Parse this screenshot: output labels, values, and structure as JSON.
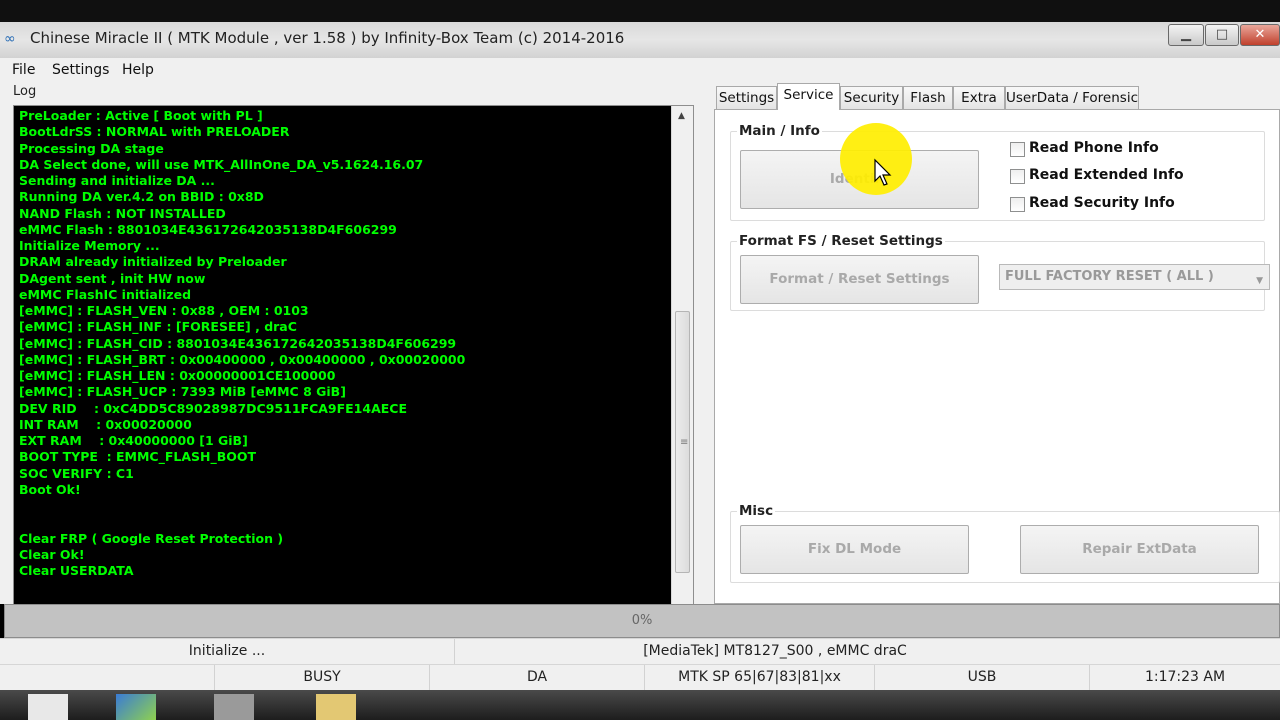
{
  "window": {
    "title": "Chinese Miracle II ( MTK Module , ver 1.58 ) by Infinity-Box Team (c) 2014-2016",
    "buttons": {
      "minimize": "▁",
      "maximize": "□",
      "close": "✕"
    }
  },
  "menu": [
    "File",
    "Settings",
    "Help"
  ],
  "log": {
    "label": "Log",
    "lines": [
      "PreLoader : Active [ Boot with PL ]",
      "BootLdrSS : NORMAL with PRELOADER",
      "Processing DA stage",
      "DA Select done, will use MTK_AllInOne_DA_v5.1624.16.07",
      "Sending and initialize DA ...",
      "Running DA ver.4.2 on BBID : 0x8D",
      "NAND Flash : NOT INSTALLED",
      "eMMC Flash : 8801034E436172642035138D4F606299",
      "Initialize Memory ...",
      "DRAM already initialized by Preloader",
      "DAgent sent , init HW now",
      "eMMC FlashIC initialized",
      "[eMMC] : FLASH_VEN : 0x88 , OEM : 0103",
      "[eMMC] : FLASH_INF : [FORESEE] , draC",
      "[eMMC] : FLASH_CID : 8801034E436172642035138D4F606299",
      "[eMMC] : FLASH_BRT : 0x00400000 , 0x00400000 , 0x00020000",
      "[eMMC] : FLASH_LEN : 0x00000001CE100000",
      "[eMMC] : FLASH_UCP : 7393 MiB [eMMC 8 GiB]",
      "DEV RID    : 0xC4DD5C89028987DC9511FCA9FE14AECE",
      "INT RAM    : 0x00020000",
      "EXT RAM    : 0x40000000 [1 GiB]",
      "BOOT TYPE  : EMMC_FLASH_BOOT",
      "SOC VERIFY : C1",
      "Boot Ok!",
      "",
      "",
      "Clear FRP ( Google Reset Protection )",
      "Clear Ok!",
      "Clear USERDATA"
    ]
  },
  "tabs": [
    {
      "label": "Settings",
      "active": false
    },
    {
      "label": "Service",
      "active": true
    },
    {
      "label": "Security",
      "active": false
    },
    {
      "label": "Flash",
      "active": false
    },
    {
      "label": "Extra",
      "active": false
    },
    {
      "label": "UserData / Forensic",
      "active": false
    }
  ],
  "service": {
    "main_info": {
      "title": "Main / Info",
      "identify_button": "Identify",
      "checkboxes": [
        {
          "label": "Read Phone Info",
          "checked": false
        },
        {
          "label": "Read Extended Info",
          "checked": false
        },
        {
          "label": "Read Security Info",
          "checked": false
        }
      ]
    },
    "format": {
      "title": "Format FS / Reset Settings",
      "button": "Format / Reset Settings",
      "combo_value": "FULL FACTORY RESET ( ALL )"
    },
    "misc": {
      "title": "Misc",
      "fix_dl_button": "Fix DL Mode",
      "repair_button": "Repair ExtData"
    }
  },
  "progress": {
    "value": 0,
    "label": "0%"
  },
  "status_row1": {
    "state": "Initialize ...",
    "device": "[MediaTek] MT8127_S00 , eMMC draC"
  },
  "status_row2": {
    "busy": "BUSY",
    "da": "DA",
    "sp": "MTK SP 65|67|83|81|xx",
    "port": "USB",
    "time": "1:17:23 AM"
  },
  "colors": {
    "log_text": "#00ff00",
    "log_bg": "#000000",
    "cursor_highlight": "#ffee00"
  }
}
